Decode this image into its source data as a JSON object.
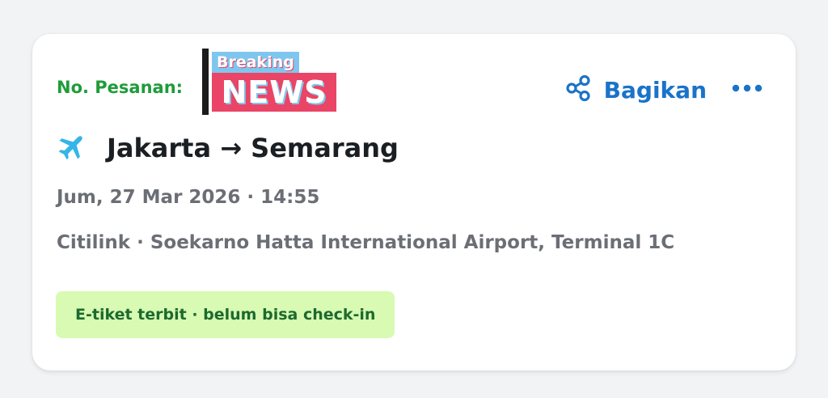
{
  "booking": {
    "order_label": "No. Pesanan:",
    "logo": {
      "breaking": "Breaking",
      "news": "NEWS"
    },
    "share_label": "Bagikan",
    "more_icon": "more-horizontal-icon",
    "share_icon": "share-icon",
    "plane_icon": "airplane-icon",
    "route": "Jakarta → Semarang",
    "datetime": "Jum, 27 Mar 2026 · 14:55",
    "airline_airport": "Citilink · Soekarno Hatta International Airport, Terminal 1C",
    "status": "E-tiket terbit · belum bisa check-in"
  },
  "colors": {
    "order_label": "#1f9c3a",
    "accent": "#1a73c9",
    "plane": "#35b5e8",
    "status_bg": "#d8fab3",
    "status_text": "#1c6a2e",
    "news_red": "#ea4466",
    "news_blue": "#7fc6ee"
  }
}
